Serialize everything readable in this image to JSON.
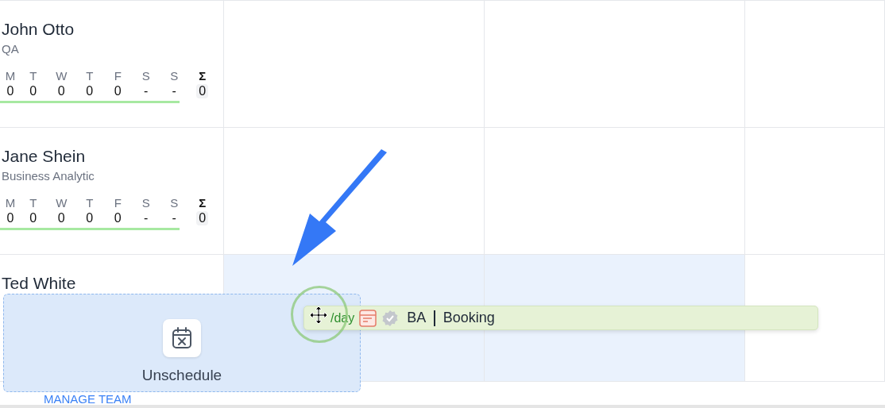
{
  "people": [
    {
      "name": "John Otto",
      "role": "QA",
      "days": [
        {
          "label": "M",
          "value": "0"
        },
        {
          "label": "T",
          "value": "0"
        },
        {
          "label": "W",
          "value": "0"
        },
        {
          "label": "T",
          "value": "0"
        },
        {
          "label": "F",
          "value": "0"
        },
        {
          "label": "S",
          "value": "-"
        },
        {
          "label": "S",
          "value": "-"
        }
      ],
      "sum_label": "Σ",
      "sum": "0",
      "cells": [
        {
          "highlighted": false
        },
        {
          "highlighted": false
        },
        {
          "highlighted": false
        }
      ]
    },
    {
      "name": "Jane Shein",
      "role": "Business Analytic",
      "days": [
        {
          "label": "M",
          "value": "0"
        },
        {
          "label": "T",
          "value": "0"
        },
        {
          "label": "W",
          "value": "0"
        },
        {
          "label": "T",
          "value": "0"
        },
        {
          "label": "F",
          "value": "0"
        },
        {
          "label": "S",
          "value": "-"
        },
        {
          "label": "S",
          "value": "-"
        }
      ],
      "sum_label": "Σ",
      "sum": "0",
      "cells": [
        {
          "highlighted": false
        },
        {
          "highlighted": false
        },
        {
          "highlighted": false
        }
      ]
    },
    {
      "name": "Ted White",
      "cells": [
        {
          "highlighted": true
        },
        {
          "highlighted": true
        },
        {
          "highlighted": false
        }
      ]
    }
  ],
  "manage_team": "MANAGE TEAM",
  "drop_zone": {
    "label": "Unschedule"
  },
  "drag_chip": {
    "hours": "/day",
    "project": "BA",
    "title": "Booking"
  }
}
